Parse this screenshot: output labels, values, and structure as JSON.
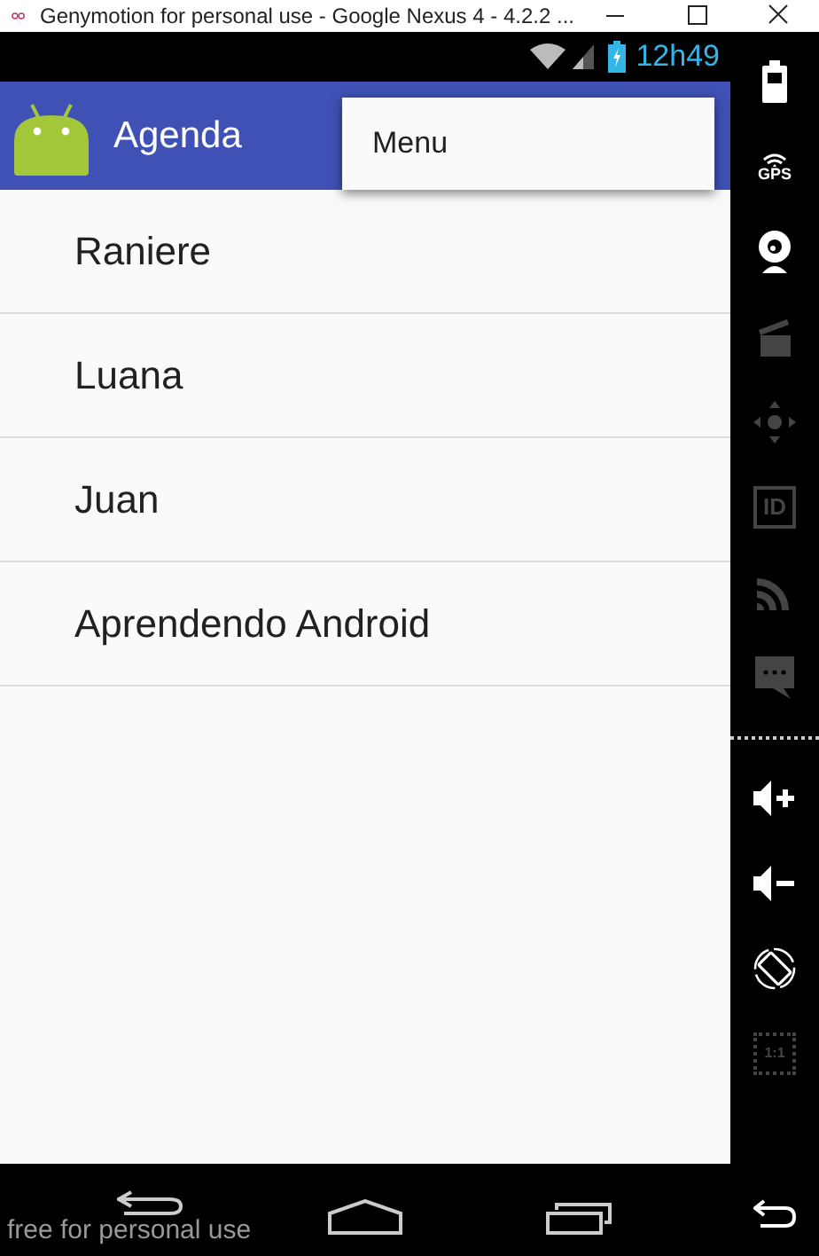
{
  "window": {
    "title": "Genymotion for personal use - Google Nexus 4 - 4.2.2 ..."
  },
  "status_bar": {
    "time": "12h49"
  },
  "action_bar": {
    "title": "Agenda"
  },
  "popup_menu": {
    "items": [
      "Menu"
    ]
  },
  "list": {
    "items": [
      "Raniere",
      "Luana",
      "Juan",
      "Aprendendo Android"
    ]
  },
  "side_toolbar": [
    {
      "kind": "battery",
      "disabled": false
    },
    {
      "kind": "gps",
      "label": "GPS",
      "disabled": false
    },
    {
      "kind": "webcam",
      "disabled": false
    },
    {
      "kind": "clapper",
      "disabled": true
    },
    {
      "kind": "dpad",
      "disabled": true
    },
    {
      "kind": "id",
      "label": "ID",
      "disabled": true
    },
    {
      "kind": "cast",
      "disabled": true
    },
    {
      "kind": "sms",
      "disabled": true
    },
    {
      "kind": "separator"
    },
    {
      "kind": "volume-up",
      "disabled": false
    },
    {
      "kind": "volume-down",
      "disabled": false
    },
    {
      "kind": "rotate",
      "disabled": false
    },
    {
      "kind": "scale",
      "label": "1:1",
      "disabled": true
    },
    {
      "kind": "spacer"
    },
    {
      "kind": "back",
      "disabled": false
    }
  ],
  "nav_overlay": {
    "text": "free for personal use"
  }
}
